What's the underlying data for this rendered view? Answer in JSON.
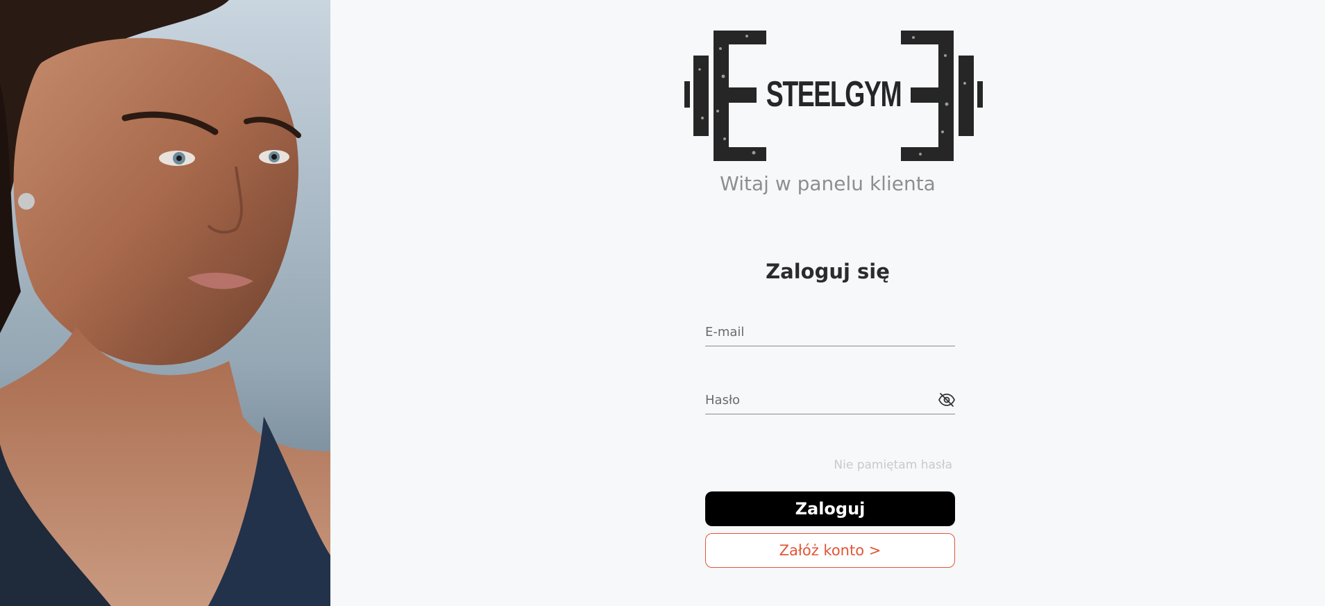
{
  "brand": {
    "logo_text": "STEELGYM",
    "subtitle": "Witaj w panelu klienta",
    "logo_icon": "barbell-logo-icon"
  },
  "hero_image": {
    "description_icon": "athlete-portrait-image"
  },
  "login": {
    "title": "Zaloguj się",
    "email_placeholder": "E-mail",
    "password_placeholder": "Hasło",
    "toggle_icon": "eye-slash-icon",
    "forgot_label": "Nie pamiętam hasła",
    "submit_label": "Zaloguj",
    "register_label": "Załóż konto >"
  },
  "colors": {
    "background": "#f7f8fa",
    "primary_button": "#000000",
    "accent": "#e35535",
    "subtitle": "#8e8e8e",
    "muted_link": "#c9c9c9"
  }
}
